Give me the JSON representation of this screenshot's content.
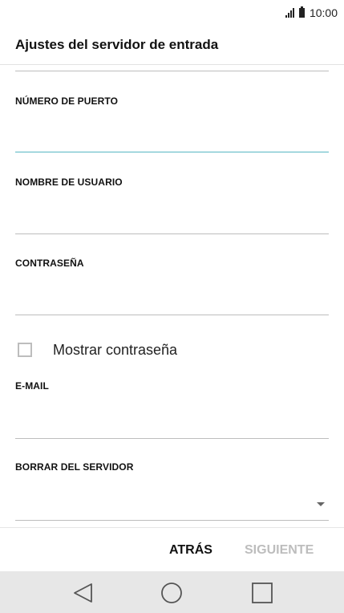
{
  "status_bar": {
    "time": "10:00"
  },
  "header": {
    "title": "Ajustes del servidor de entrada"
  },
  "form": {
    "port": {
      "label": "NÚMERO DE PUERTO",
      "value": ""
    },
    "username": {
      "label": "NOMBRE DE USUARIO",
      "value": ""
    },
    "password": {
      "label": "CONTRASEÑA",
      "value": ""
    },
    "show_password": {
      "label": "Mostrar contraseña",
      "checked": false
    },
    "email": {
      "label": "E-MAIL",
      "value": ""
    },
    "delete_from_server": {
      "label": "BORRAR DEL SERVIDOR",
      "value": ""
    }
  },
  "actions": {
    "back_label": "ATRÁS",
    "next_label": "SIGUIENTE"
  },
  "colors": {
    "accent_underline": "#56b6c2",
    "disabled_text": "#bdbdbd",
    "nav_bar_bg": "#e7e7e7"
  },
  "icons": [
    "signal-icon",
    "battery-icon",
    "dropdown-arrow-icon",
    "nav-back-icon",
    "nav-home-icon",
    "nav-recents-icon"
  ]
}
